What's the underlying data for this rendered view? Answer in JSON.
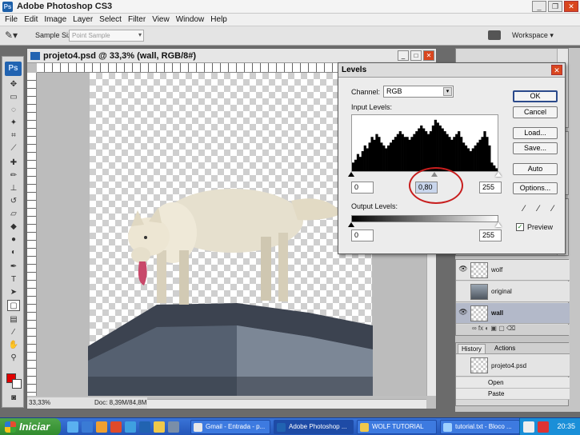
{
  "app": {
    "title": "Adobe Photoshop CS3",
    "icon_text": "Ps"
  },
  "window_controls": [
    "minimize",
    "restore",
    "close"
  ],
  "menu": [
    "File",
    "Edit",
    "Image",
    "Layer",
    "Select",
    "Filter",
    "View",
    "Window",
    "Help"
  ],
  "options": {
    "sample_size_label": "Sample Size:",
    "sample_size_value": "Point Sample",
    "workspace_label": "Workspace ▾"
  },
  "toolbox": {
    "logo": "Ps",
    "tools": [
      "move-icon",
      "marquee-icon",
      "lasso-icon",
      "magic-wand-icon",
      "crop-icon",
      "slice-icon",
      "healing-icon",
      "brush-icon",
      "stamp-icon",
      "history-brush-icon",
      "eraser-icon",
      "bucket-icon",
      "blur-icon",
      "dodge-icon",
      "pen-icon",
      "type-icon",
      "path-select-icon",
      "shape-icon",
      "notes-icon",
      "eyedropper-icon",
      "hand-icon",
      "zoom-icon"
    ],
    "fg_color": "#e00000",
    "bg_color": "#ffffff"
  },
  "document": {
    "title": "projeto4.psd @ 33,3% (wall, RGB/8#)",
    "zoom": "33,33%",
    "doc_info": "Doc: 8,39M/84,8M"
  },
  "levels": {
    "title": "Levels",
    "channel_label": "Channel:",
    "channel_value": "RGB",
    "input_label": "Input Levels:",
    "input_black": "0",
    "input_gamma": "0,80",
    "input_white": "255",
    "output_label": "Output Levels:",
    "output_black": "0",
    "output_white": "255",
    "buttons": {
      "ok": "OK",
      "cancel": "Cancel",
      "load": "Load...",
      "save": "Save...",
      "auto": "Auto",
      "options": "Options..."
    },
    "preview_label": "Preview",
    "preview_checked": true,
    "histogram": [
      3,
      4,
      6,
      5,
      7,
      9,
      8,
      10,
      12,
      11,
      13,
      12,
      10,
      9,
      8,
      9,
      10,
      11,
      12,
      13,
      14,
      13,
      12,
      12,
      11,
      12,
      13,
      14,
      15,
      16,
      15,
      14,
      13,
      14,
      16,
      18,
      17,
      16,
      15,
      14,
      13,
      12,
      11,
      12,
      13,
      14,
      12,
      10,
      9,
      8,
      7,
      8,
      9,
      10,
      11,
      12,
      14,
      12,
      9,
      3,
      2,
      1
    ]
  },
  "layers": [
    {
      "name": "wolf",
      "visible": true,
      "selected": false,
      "thumb": "transparent"
    },
    {
      "name": "original",
      "visible": false,
      "selected": false,
      "thumb": "photo"
    },
    {
      "name": "wall",
      "visible": true,
      "selected": true,
      "thumb": "transparent"
    }
  ],
  "history": {
    "tabs": [
      "History",
      "Actions"
    ],
    "snapshot": "projeto4.psd",
    "steps": [
      "Open",
      "Paste"
    ]
  },
  "taskbar": {
    "start": "Iniciar",
    "tasks": [
      {
        "label": "Gmail - Entrada - p...",
        "color": "#e8e8e8",
        "active": false
      },
      {
        "label": "Adobe Photoshop ...",
        "color": "#2163b1",
        "active": true
      },
      {
        "label": "WOLF TUTORIAL",
        "color": "#f0c84a",
        "active": false
      },
      {
        "label": "tutorial.txt - Bloco ...",
        "color": "#9ed0ff",
        "active": false
      }
    ],
    "clock": "20:35"
  }
}
